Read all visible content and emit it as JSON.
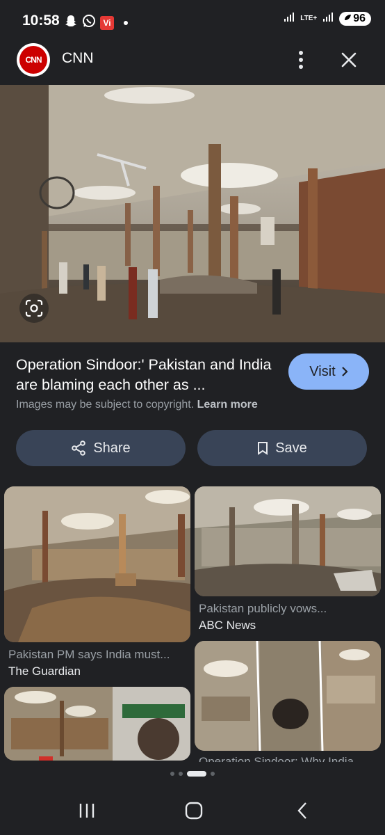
{
  "status_bar": {
    "time": "10:58",
    "notification_icons": [
      "snapchat-icon",
      "whatsapp-icon",
      "vi-app-icon"
    ],
    "vi_label": "Vi",
    "network_label": "LTE+",
    "battery": "96"
  },
  "header": {
    "source_logo_text": "CNN",
    "source_name": "CNN"
  },
  "result": {
    "title": "Operation Sindoor:' Pakistan and India are blaming each other as ...",
    "visit_label": "Visit",
    "copyright_text": "Images may be subject to copyright.",
    "learn_more_label": "Learn more"
  },
  "actions": {
    "share_label": "Share",
    "save_label": "Save"
  },
  "related": [
    {
      "title": "Pakistan PM says India must...",
      "source": "The Guardian"
    },
    {
      "title": "Pakistan publicly vows...",
      "source": "ABC News"
    },
    {
      "title": "Operation Sindoor: Why India...",
      "source": ""
    },
    {
      "title": "",
      "source": ""
    }
  ],
  "colors": {
    "background": "#202124",
    "visit_button": "#8ab4f8",
    "action_button": "#394457",
    "cnn_red": "#cc0000"
  }
}
